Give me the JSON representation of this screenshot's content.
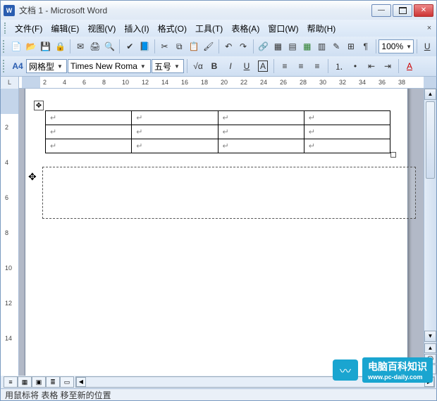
{
  "title": "文档 1 - Microsoft Word",
  "menus": {
    "file": "文件(F)",
    "edit": "编辑(E)",
    "view": "视图(V)",
    "insert": "插入(I)",
    "format": "格式(O)",
    "tools": "工具(T)",
    "table": "表格(A)",
    "window": "窗口(W)",
    "help": "帮助(H)"
  },
  "toolbar1": {
    "zoom": "100%"
  },
  "toolbar2": {
    "style": "网格型",
    "font": "Times New Roma",
    "size": "五号",
    "root": "√α",
    "B": "B",
    "I": "I",
    "U": "U",
    "boxA": "A",
    "fontcolorA": "A"
  },
  "ruler": {
    "corner": "L",
    "ticks": [
      "2",
      "4",
      "6",
      "8",
      "10",
      "12",
      "14",
      "16",
      "18",
      "20",
      "22",
      "24",
      "26",
      "28",
      "30",
      "32",
      "34",
      "36",
      "38"
    ]
  },
  "vruler": {
    "ticks": [
      "2",
      "4",
      "6",
      "8",
      "10",
      "12",
      "14"
    ]
  },
  "table_data": {
    "rows": 3,
    "cols": 4,
    "cell_marker": "↵"
  },
  "drag_ghost": {
    "visible": true
  },
  "status": "用鼠标将 表格 移至新的位置",
  "watermark": {
    "brand": "电脑百科知识",
    "url": "www.pc-daily.com",
    "icon": "〰"
  }
}
